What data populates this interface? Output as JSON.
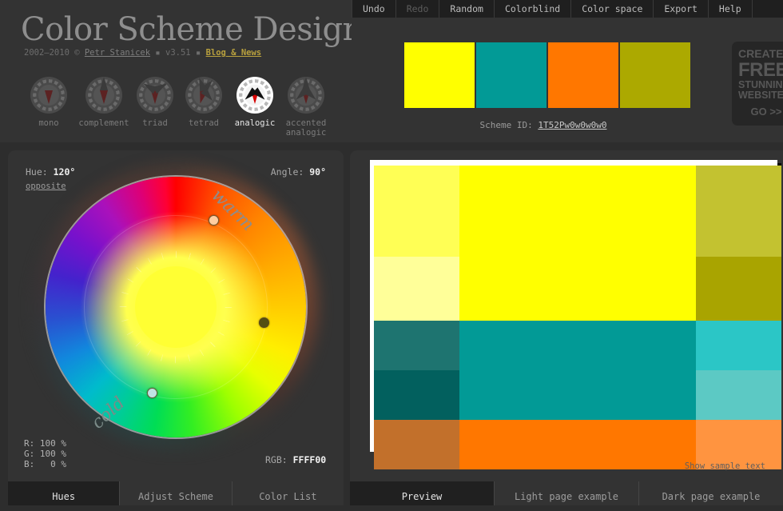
{
  "app": {
    "title": "Color Scheme Designer",
    "subtitle_years": "2002–2010 © ",
    "author": "Petr Stanicek",
    "sep1": " ▪ ",
    "version": "v3.51",
    "sep2": " ▪ ",
    "news_link": "Blog & News"
  },
  "topnav": {
    "items": [
      {
        "label": "Undo",
        "disabled": false
      },
      {
        "label": "Redo",
        "disabled": true
      },
      {
        "label": "Random",
        "disabled": false
      },
      {
        "label": "Colorblind",
        "disabled": false
      },
      {
        "label": "Color space",
        "disabled": false
      },
      {
        "label": "Export",
        "disabled": false
      },
      {
        "label": "Help",
        "disabled": false
      }
    ]
  },
  "scheme_types": {
    "items": [
      {
        "label": "mono",
        "icon": "dial-mono-icon",
        "active": false
      },
      {
        "label": "complement",
        "icon": "dial-complement-icon",
        "active": false
      },
      {
        "label": "triad",
        "icon": "dial-triad-icon",
        "active": false
      },
      {
        "label": "tetrad",
        "icon": "dial-tetrad-icon",
        "active": false
      },
      {
        "label": "analogic",
        "icon": "dial-analogic-icon",
        "active": true
      },
      {
        "label": "accented analogic",
        "icon": "dial-accented-analogic-icon",
        "active": false
      }
    ]
  },
  "scheme": {
    "swatches": [
      "#FFFF00",
      "#029A96",
      "#FF7700",
      "#ACA900"
    ],
    "id_label": "Scheme ID: ",
    "id_value": "1T52Pw0w0w0w0"
  },
  "ad": {
    "line1": "CREATE",
    "line2": "FREE",
    "line3": "STUNNING",
    "line4": "WEBSITES",
    "line5": "GO >>"
  },
  "wheel": {
    "hue_label": "Hue: ",
    "hue_value": "120°",
    "opposite_link": "opposite",
    "angle_label": "Angle: ",
    "angle_value": "90°",
    "warm_word": "warm",
    "cold_word": "cold",
    "rgb_percent_text": "R: 100 %\nG: 100 %\nB:   0 %",
    "rgb_hex_label": "RGB: ",
    "rgb_hex_value": "FFFF00",
    "markers": [
      {
        "name": "marker-primary",
        "color": "#FFCDA0",
        "angle_deg": 24,
        "radius": 118
      },
      {
        "name": "marker-secondary",
        "color": "#544F12",
        "angle_deg": 100,
        "radius": 113
      },
      {
        "name": "marker-tertiary",
        "color": "#BFE3E3",
        "angle_deg": 195,
        "radius": 112
      }
    ]
  },
  "left_tabs": {
    "items": [
      {
        "label": "Hues",
        "active": true
      },
      {
        "label": "Adjust Scheme",
        "active": false
      },
      {
        "label": "Color List",
        "active": false
      }
    ]
  },
  "right_tabs": {
    "items": [
      {
        "label": "Preview",
        "active": true
      },
      {
        "label": "Light page example",
        "active": false
      },
      {
        "label": "Dark page example",
        "active": false
      }
    ]
  },
  "preview": {
    "show_sample_text": "Show sample text",
    "cells": [
      "#FFFF55",
      "#FFFF00",
      "#C3C230",
      "#FFFF99",
      "#FFFF00",
      "#A9A400",
      "#1E7470",
      "#029A96",
      "#2BC6C6",
      "#02605E",
      "#029A96",
      "#5CC9C4",
      "#C2702B",
      "#FF7700",
      "#FF9440",
      "#AA4A00",
      "#FF7700",
      "#FFB480"
    ],
    "grid_columns": 3
  }
}
